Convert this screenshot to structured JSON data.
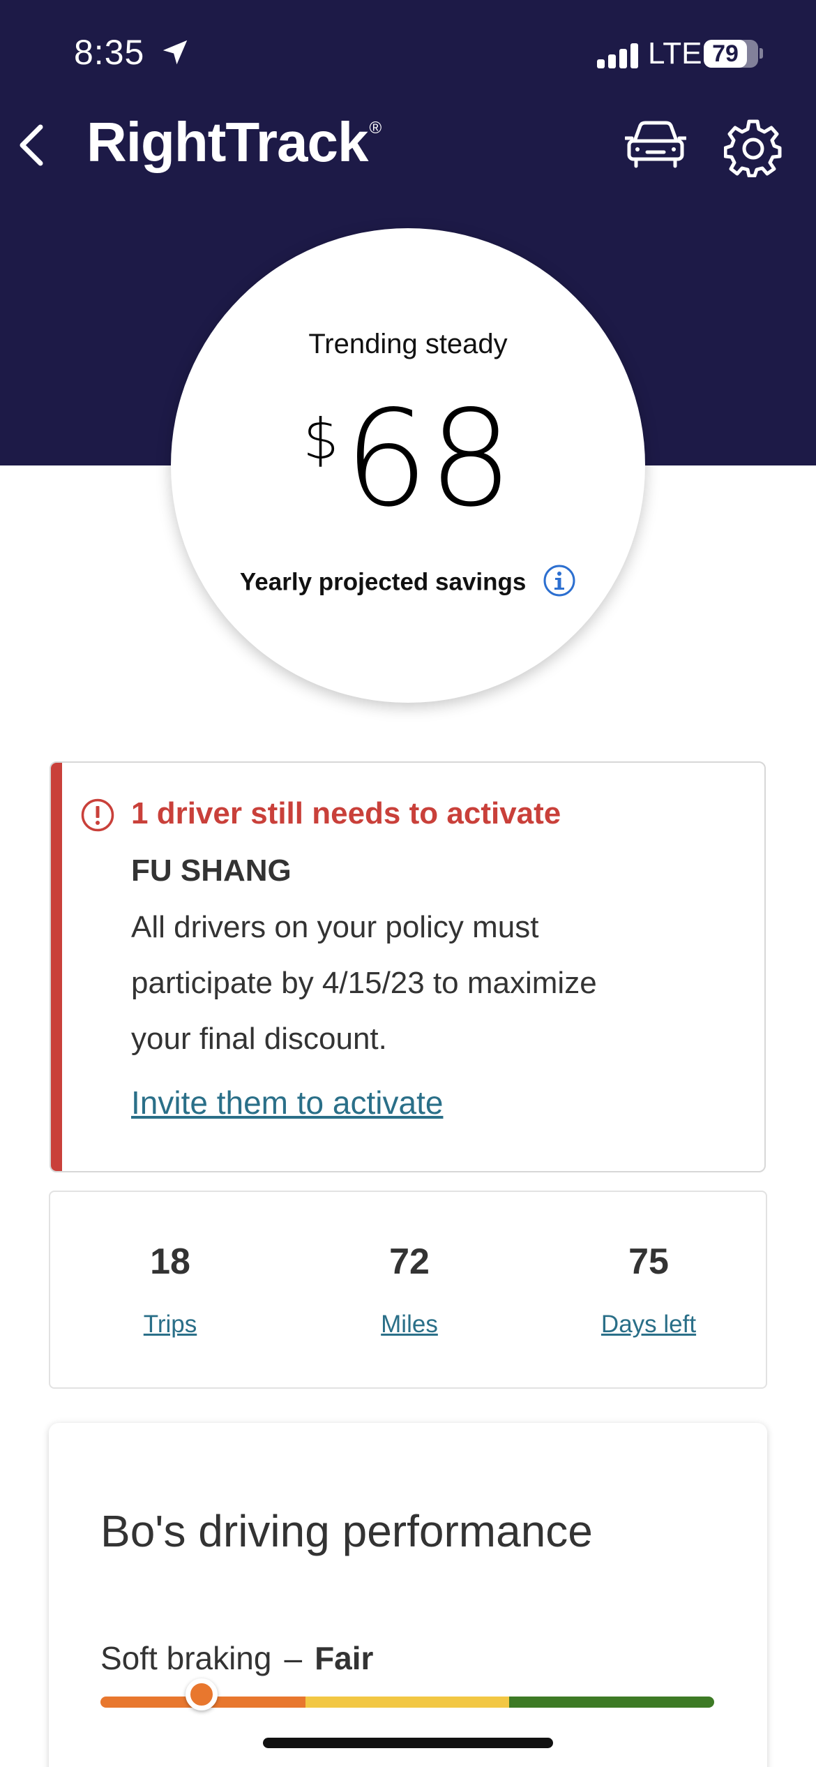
{
  "status_bar": {
    "time": "8:35",
    "network": "LTE",
    "battery_percent": "79",
    "battery_level": 0.79,
    "signal_bars": 4
  },
  "header": {
    "logo_text": "RightTrack",
    "logo_mark": "®",
    "back_icon": "chevron-left-icon",
    "car_icon": "car-icon",
    "settings_icon": "gear-icon"
  },
  "savings": {
    "trend": "Trending steady",
    "currency": "$",
    "amount": "68",
    "label": "Yearly projected savings",
    "info_icon": "info-icon"
  },
  "alert": {
    "title": "1 driver still needs to activate",
    "driver_name": "FU SHANG",
    "message": "All drivers on your policy must participate by 4/15/23 to maximize your final discount.",
    "link_text": "Invite them to activate",
    "accent_color": "#c9403a"
  },
  "stats": [
    {
      "value": "18",
      "label": "Trips"
    },
    {
      "value": "72",
      "label": "Miles"
    },
    {
      "value": "75",
      "label": "Days left"
    }
  ],
  "performance": {
    "title": "Bo's driving performance",
    "metric_label": "Soft braking",
    "separator": "–",
    "rating": "Fair",
    "scale_position": 0.165,
    "scale_colors": [
      "#e8772e",
      "#f2c744",
      "#3d7a25"
    ]
  },
  "colors": {
    "header_bg": "#1d1a47",
    "link": "#2a6f88"
  }
}
